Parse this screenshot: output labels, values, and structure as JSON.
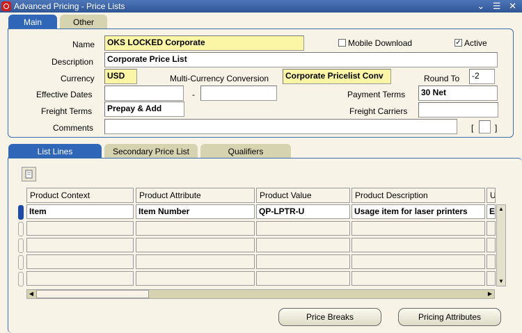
{
  "window": {
    "title": "Advanced Pricing - Price Lists",
    "controls": "⌄ ☰ ✕"
  },
  "top_tabs": [
    {
      "label": "Main",
      "active": true
    },
    {
      "label": "Other",
      "active": false
    }
  ],
  "header": {
    "name_label": "Name",
    "name_value": "OKS LOCKED Corporate",
    "mobile_download_label": "Mobile Download",
    "mobile_download_checked": false,
    "active_label": "Active",
    "active_checked": true,
    "description_label": "Description",
    "description_value": "Corporate Price List",
    "currency_label": "Currency",
    "currency_value": "USD",
    "multi_currency_label": "Multi-Currency Conversion",
    "multi_currency_value": "Corporate Pricelist Conv",
    "round_to_label": "Round To",
    "round_to_value": "-2",
    "effective_dates_label": "Effective Dates",
    "effective_from": "",
    "dates_separator": "-",
    "effective_to": "",
    "payment_terms_label": "Payment Terms",
    "payment_terms_value": "30 Net",
    "freight_terms_label": "Freight Terms",
    "freight_terms_value": "Prepay & Add",
    "freight_carriers_label": "Freight Carriers",
    "freight_carriers_value": "",
    "comments_label": "Comments",
    "comments_value": "",
    "dff_open": "[",
    "dff_close": "]"
  },
  "lines_tabs": [
    {
      "label": "List Lines",
      "active": true
    },
    {
      "label": "Secondary Price List",
      "active": false
    },
    {
      "label": "Qualifiers",
      "active": false
    }
  ],
  "lines_table": {
    "columns": [
      "Product Context",
      "Product Attribute",
      "Product Value",
      "Product Description",
      "U"
    ],
    "rows": [
      [
        "Item",
        "Item Number",
        "QP-LPTR-U",
        "Usage item for laser printers",
        "E"
      ],
      [
        "",
        "",
        "",
        "",
        ""
      ],
      [
        "",
        "",
        "",
        "",
        ""
      ],
      [
        "",
        "",
        "",
        "",
        ""
      ],
      [
        "",
        "",
        "",
        "",
        ""
      ]
    ]
  },
  "buttons": {
    "price_breaks": "Price Breaks",
    "pricing_attributes": "Pricing Attributes"
  },
  "colors": {
    "tab_active": "#2f66b8",
    "tab_inactive": "#d6d3b0",
    "required_field": "#fbf6a6",
    "background": "#f7f3e6"
  }
}
